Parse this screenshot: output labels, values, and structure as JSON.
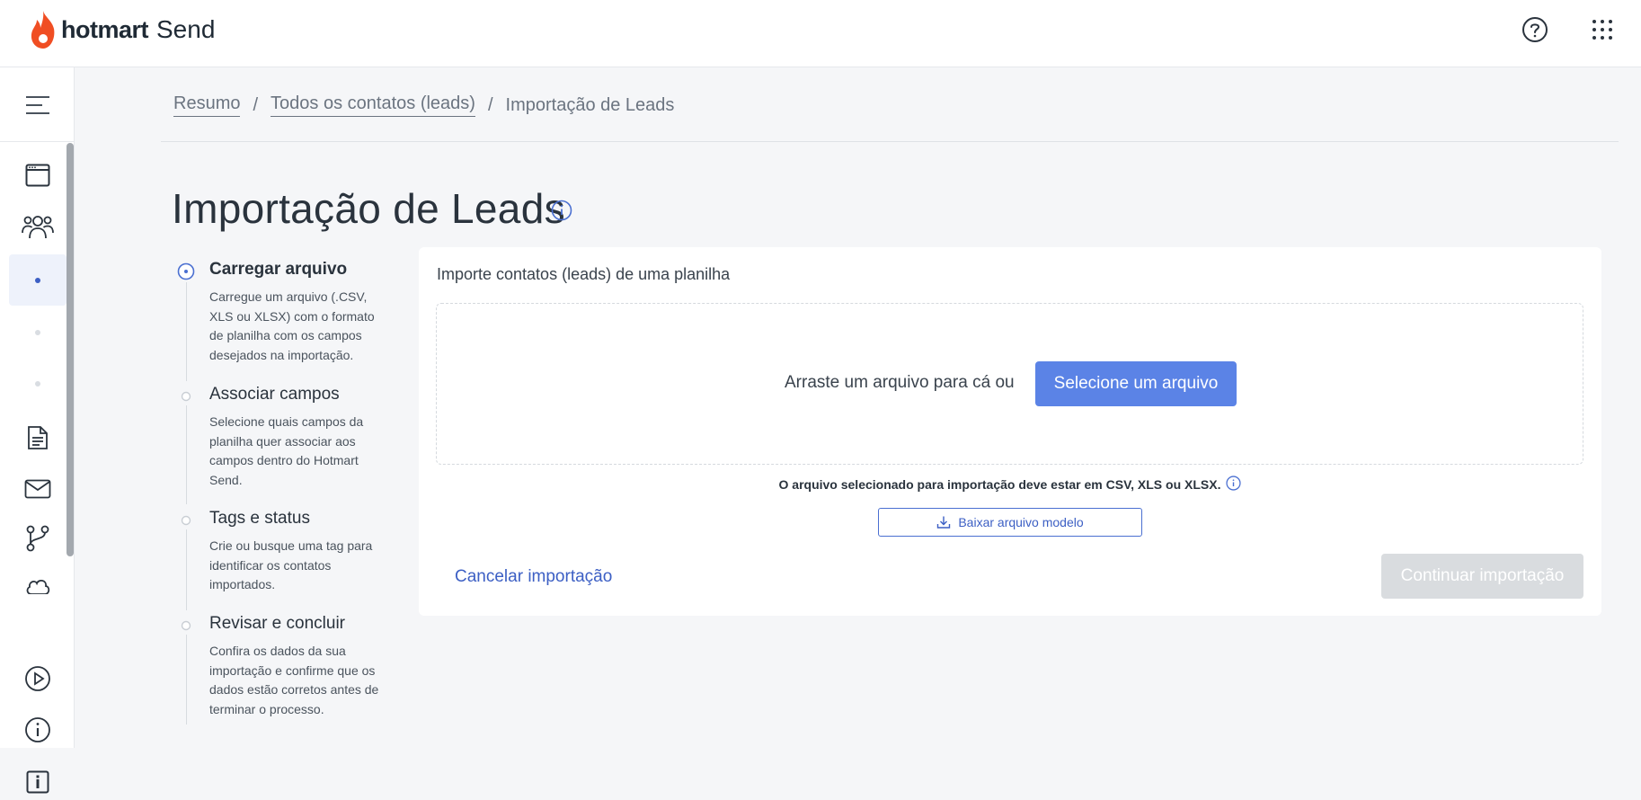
{
  "header": {
    "brand": "hotmart",
    "product": "Send",
    "icons": [
      "help-icon",
      "apps-grid-icon"
    ]
  },
  "sidebar": {
    "items": [
      {
        "name": "menu-toggle",
        "icon": "hamburger-icon"
      },
      {
        "name": "dashboard",
        "icon": "window-icon"
      },
      {
        "name": "contacts",
        "icon": "users-icon"
      },
      {
        "name": "step-1",
        "icon": "dot-active"
      },
      {
        "name": "step-2",
        "icon": "dot"
      },
      {
        "name": "step-3",
        "icon": "dot"
      },
      {
        "name": "documents",
        "icon": "document-icon"
      },
      {
        "name": "email",
        "icon": "envelope-icon"
      },
      {
        "name": "automations",
        "icon": "branch-icon"
      },
      {
        "name": "integrations",
        "icon": "cloud-icon"
      },
      {
        "name": "tutorials",
        "icon": "play-icon"
      },
      {
        "name": "about",
        "icon": "info-icon"
      },
      {
        "name": "info-box",
        "icon": "info-square-icon"
      }
    ]
  },
  "breadcrumb": {
    "items": [
      "Resumo",
      "Todos os contatos (leads)",
      "Importação de Leads"
    ],
    "separator": "/"
  },
  "page": {
    "title": "Importação de Leads"
  },
  "steps": [
    {
      "title": "Carregar arquivo",
      "description": "Carregue um arquivo (.CSV, XLS ou XLSX) com o formato de planilha com os campos desejados na importação.",
      "current": true
    },
    {
      "title": "Associar campos",
      "description": "Selecione quais campos da planilha quer associar aos campos dentro do Hotmart Send.",
      "current": false
    },
    {
      "title": "Tags e status",
      "description": "Crie ou busque uma tag para identificar os contatos importados.",
      "current": false
    },
    {
      "title": "Revisar e concluir",
      "description": "Confira os dados da sua importação e confirme que os dados estão corretos antes de terminar o processo.",
      "current": false
    }
  ],
  "upload": {
    "heading": "Importe contatos (leads) de uma planilha",
    "drop_text": "Arraste um arquivo para cá ou",
    "select_button": "Selecione um arquivo",
    "format_note": "O arquivo selecionado para importação deve estar em CSV, XLS ou XLSX.",
    "download_button": "Baixar arquivo modelo",
    "cancel_link": "Cancelar importação",
    "continue_button": "Continuar importação"
  },
  "colors": {
    "primary": "#5b83e6",
    "link": "#3c5fc4",
    "disabled": "#d9dcdf",
    "brand_flame": "#f04e23"
  }
}
